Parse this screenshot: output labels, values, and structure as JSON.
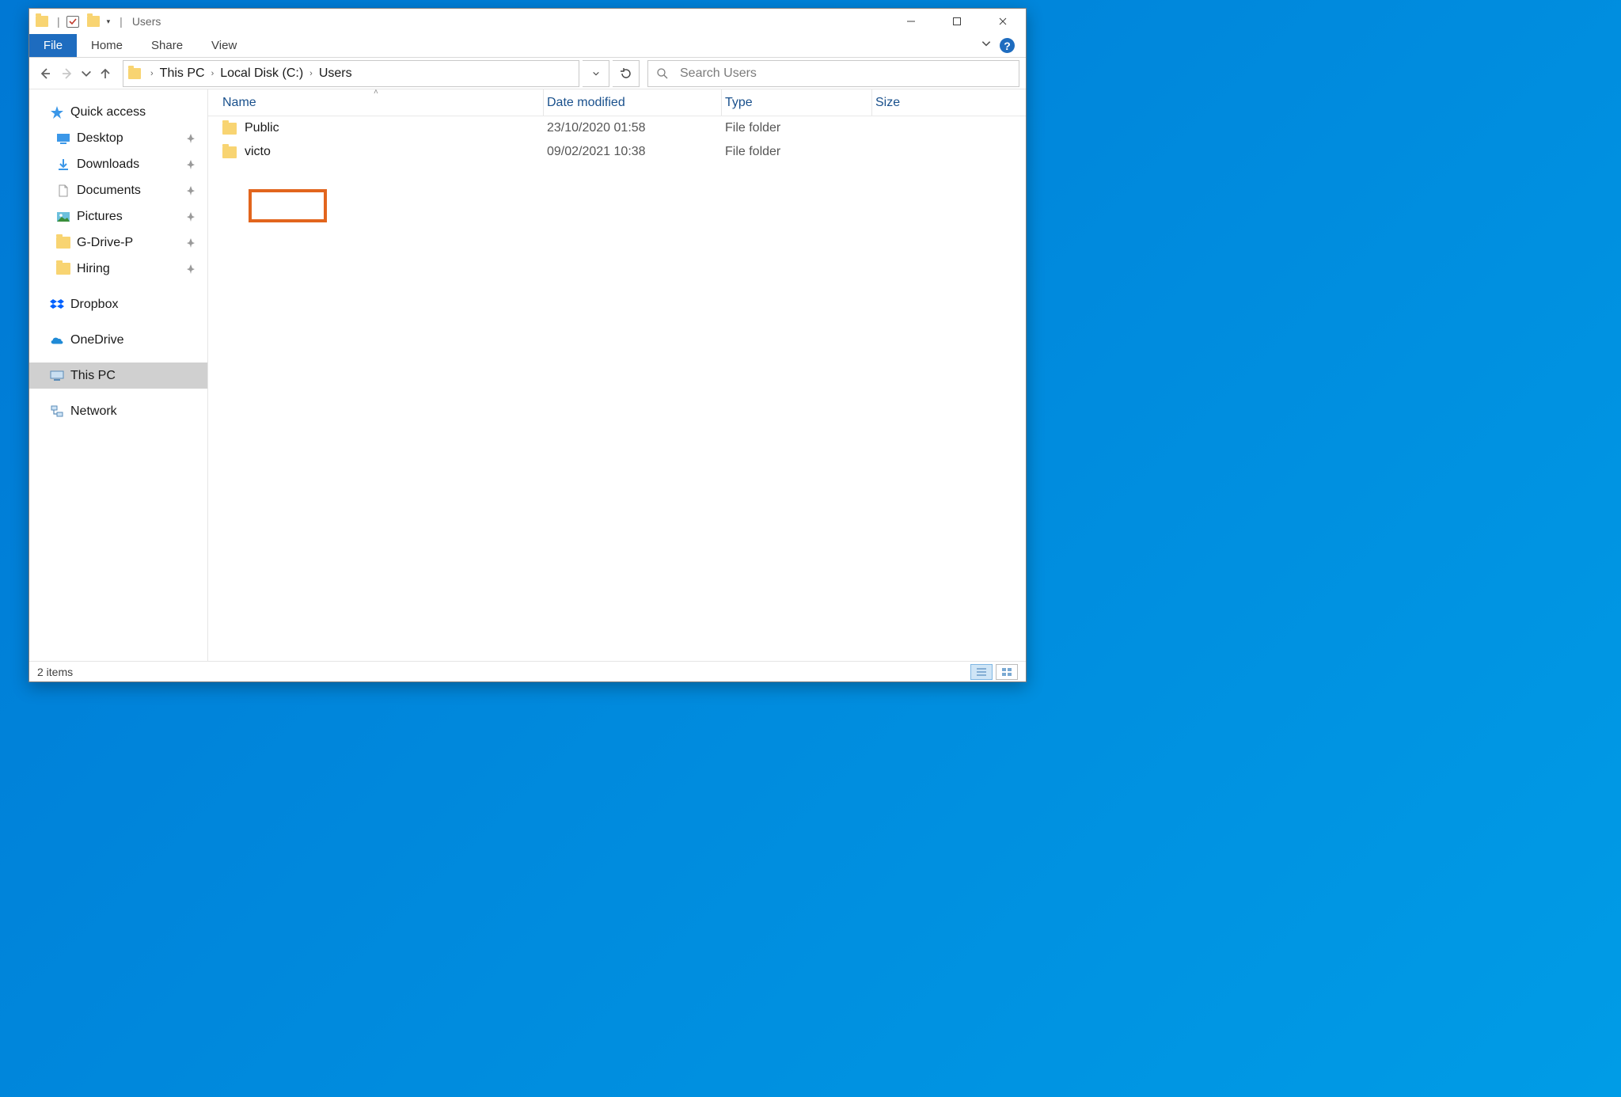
{
  "window": {
    "title": "Users"
  },
  "ribbon": {
    "file": "File",
    "tabs": [
      "Home",
      "Share",
      "View"
    ]
  },
  "breadcrumb": {
    "items": [
      "This PC",
      "Local Disk (C:)",
      "Users"
    ]
  },
  "search": {
    "placeholder": "Search Users"
  },
  "sidebar": {
    "quick_access": "Quick access",
    "items": [
      {
        "label": "Desktop",
        "icon": "desktop",
        "pinned": true
      },
      {
        "label": "Downloads",
        "icon": "downloads",
        "pinned": true
      },
      {
        "label": "Documents",
        "icon": "documents",
        "pinned": true
      },
      {
        "label": "Pictures",
        "icon": "pictures",
        "pinned": true
      },
      {
        "label": "G-Drive-P",
        "icon": "folder",
        "pinned": true
      },
      {
        "label": "Hiring",
        "icon": "folder",
        "pinned": true
      }
    ],
    "dropbox": "Dropbox",
    "onedrive": "OneDrive",
    "this_pc": "This PC",
    "network": "Network"
  },
  "columns": {
    "name": "Name",
    "date": "Date modified",
    "type": "Type",
    "size": "Size"
  },
  "rows": [
    {
      "name": "Public",
      "date": "23/10/2020 01:58",
      "type": "File folder",
      "size": ""
    },
    {
      "name": "victo",
      "date": "09/02/2021 10:38",
      "type": "File folder",
      "size": ""
    }
  ],
  "highlighted_row_index": 1,
  "status": {
    "items": "2 items"
  }
}
